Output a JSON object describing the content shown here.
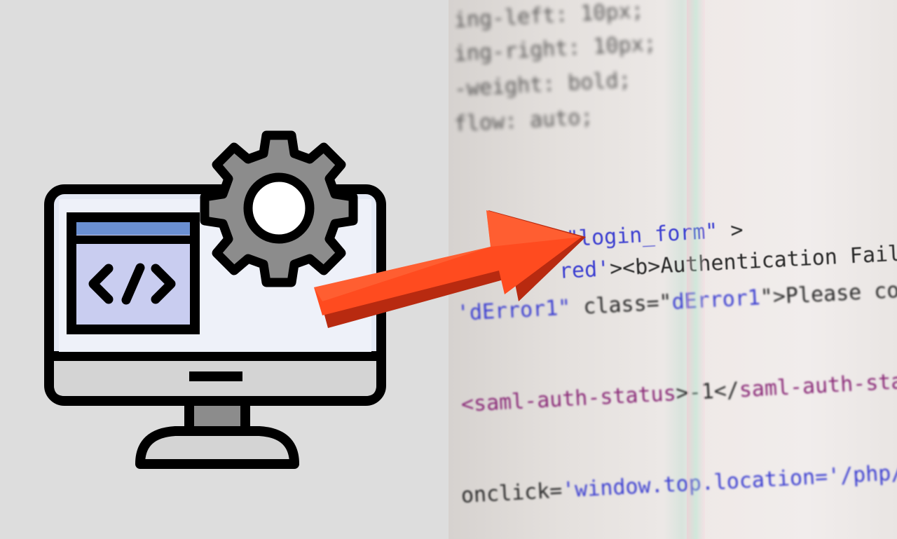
{
  "illustration": {
    "monitor_icon": "monitor-icon",
    "gear_icon": "gear-icon",
    "code_symbol": "</>",
    "colors": {
      "outline": "#000000",
      "screen": "#e3e8f4",
      "window_body": "#c9cdf0",
      "window_bar": "#6a8fd1",
      "gear": "#8c8c8c",
      "bezel": "#d4d4d4",
      "arrow": "#ff4b1f"
    }
  },
  "code": {
    "line1": "ing-left: 10px;",
    "line2": "ing-right: 10px;",
    "line3": "-weight: bold;",
    "line4": "flow: auto;",
    "line5a": "\"login_form\"",
    "line5b": " >",
    "line6a": "red'",
    "line6b": "><b>Authentication Failed</b>",
    "line7a": "'dError1\"",
    "line7b": " class=\"",
    "line7c": "dError1",
    "line7d": "\">Please contact t",
    "line8a": "<saml-auth-status",
    "line8b": ">-1</",
    "line8c": "saml-auth-status",
    "line8d": ">",
    "line9a": "onclick=",
    "line9b": "'window.top.location='/php/login.p"
  }
}
